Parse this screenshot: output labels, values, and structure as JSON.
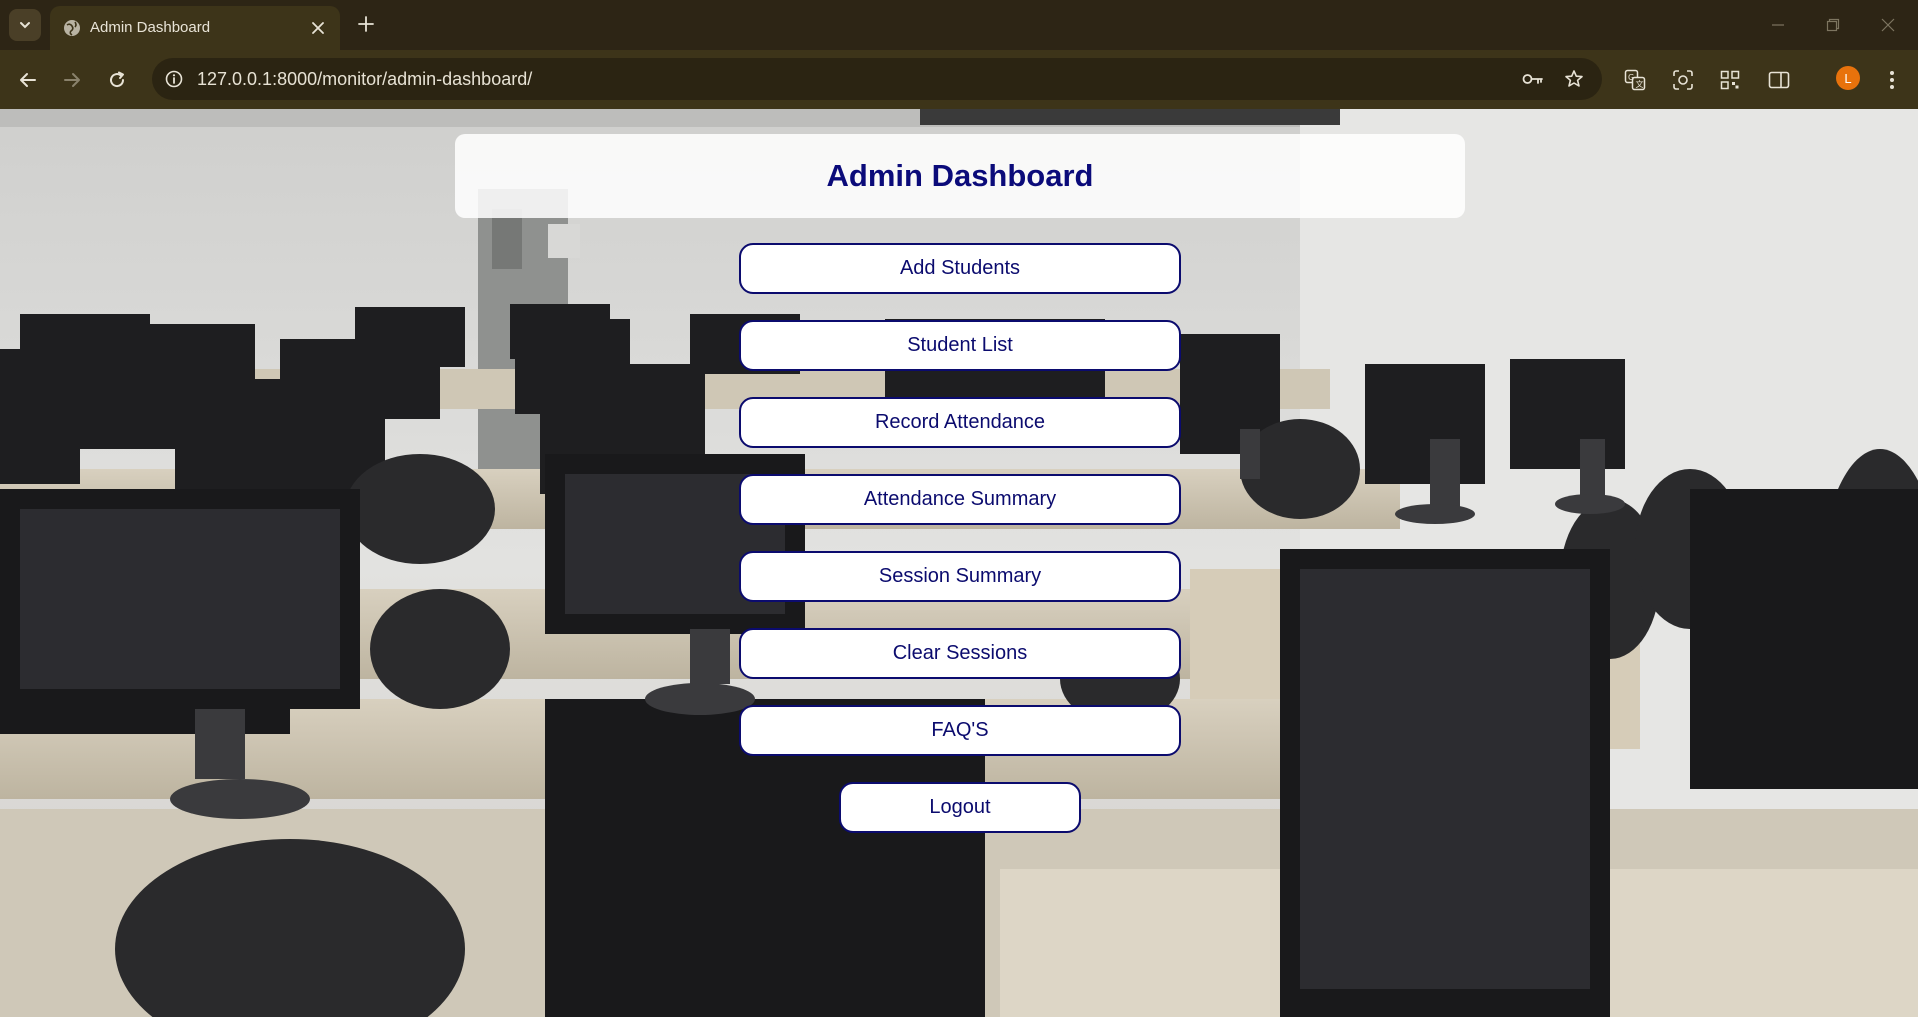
{
  "browser": {
    "tab": {
      "title": "Admin Dashboard"
    },
    "url": "127.0.0.1:8000/monitor/admin-dashboard/",
    "profile_initial": "L"
  },
  "dashboard": {
    "title": "Admin Dashboard",
    "buttons": [
      {
        "label": "Add Students"
      },
      {
        "label": "Student List"
      },
      {
        "label": "Record Attendance"
      },
      {
        "label": "Attendance Summary"
      },
      {
        "label": "Session Summary"
      },
      {
        "label": "Clear Sessions"
      },
      {
        "label": "FAQ'S"
      }
    ],
    "logout_label": "Logout"
  },
  "colors": {
    "button_text": "#0b0b6e",
    "button_border": "#0b0b6e",
    "title_text": "#0b0b7a",
    "avatar": "#e8720c",
    "chrome_bg": "#2d2515"
  },
  "icons": {
    "tab_search": "chevron-down-icon",
    "tab_favicon": "globe-icon",
    "tab_close": "close-icon",
    "new_tab": "plus-icon",
    "back": "arrow-left-icon",
    "forward": "arrow-right-icon",
    "reload": "reload-icon",
    "site_info": "info-icon",
    "password": "key-icon",
    "bookmark": "star-icon",
    "translate": "translate-icon",
    "lens": "camera-search-icon",
    "qr": "qr-code-icon",
    "side_panel": "side-panel-icon",
    "menu": "kebab-menu-icon"
  }
}
